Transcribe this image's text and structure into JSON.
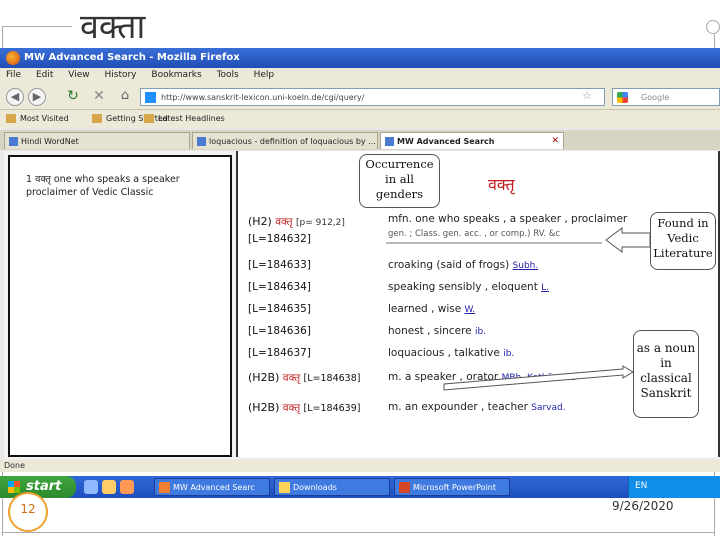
{
  "slide": {
    "title": "वक्ता",
    "number": "12",
    "date": "9/26/2020"
  },
  "browser": {
    "window_title": "MW Advanced Search - Mozilla Firefox",
    "menu": [
      "File",
      "Edit",
      "View",
      "History",
      "Bookmarks",
      "Tools",
      "Help"
    ],
    "url": "http://www.sanskrit-lexicon.uni-koeln.de/cgi/query/",
    "search_placeholder": "Google",
    "bookmarks": [
      "Most Visited",
      "Getting Started",
      "Latest Headlines"
    ],
    "tabs": [
      {
        "label": "Hindi WordNet",
        "active": false
      },
      {
        "label": "loquacious - definition of loquacious by ...",
        "active": false
      },
      {
        "label": "MW Advanced Search",
        "active": true
      }
    ],
    "status": "Done"
  },
  "left_panel": {
    "text": "1 वक्तृ one who speaks a speaker proclaimer of Vedic Classic"
  },
  "entry": {
    "headword": "वक्तृ",
    "rows": [
      {
        "hk": "(H2)",
        "dev": "वक्तृ",
        "ref": "[p= 912,2]",
        "lid": "[L=184632]",
        "def": "mfn. one who speaks , a speaker , proclaimer",
        "sub": "gen. ; Class. gen. acc. , or comp.) RV. &c"
      },
      {
        "lid": "[L=184633]",
        "def": "croaking (said of frogs)",
        "src": "Subh."
      },
      {
        "lid": "[L=184634]",
        "def": "speaking sensibly , eloquent",
        "src": "L."
      },
      {
        "lid": "[L=184635]",
        "def": "learned , wise",
        "src": "W."
      },
      {
        "lid": "[L=184636]",
        "def": "honest , sincere",
        "src": "ib."
      },
      {
        "lid": "[L=184637]",
        "def": "loquacious , talkative",
        "src": "ib."
      },
      {
        "hk": "(H2B)",
        "dev": "वक्तृ",
        "lid": "[L=184638]",
        "def": "m. a speaker , orator",
        "src": "MBh. Kathās. &c"
      },
      {
        "hk": "(H2B)",
        "dev": "वक्तृ",
        "lid": "[L=184639]",
        "def": "m. an expounder , teacher",
        "src": "Sarvad."
      }
    ]
  },
  "taskbar": {
    "start": "start",
    "tasks": [
      "MW Advanced Searc",
      "Downloads",
      "Microsoft PowerPoint"
    ],
    "tray": "EN"
  },
  "callouts": {
    "genders": "Occurrence in all genders",
    "vedic": "Found in Vedic Literature",
    "classical": "as a noun in classical Sanskrit"
  }
}
